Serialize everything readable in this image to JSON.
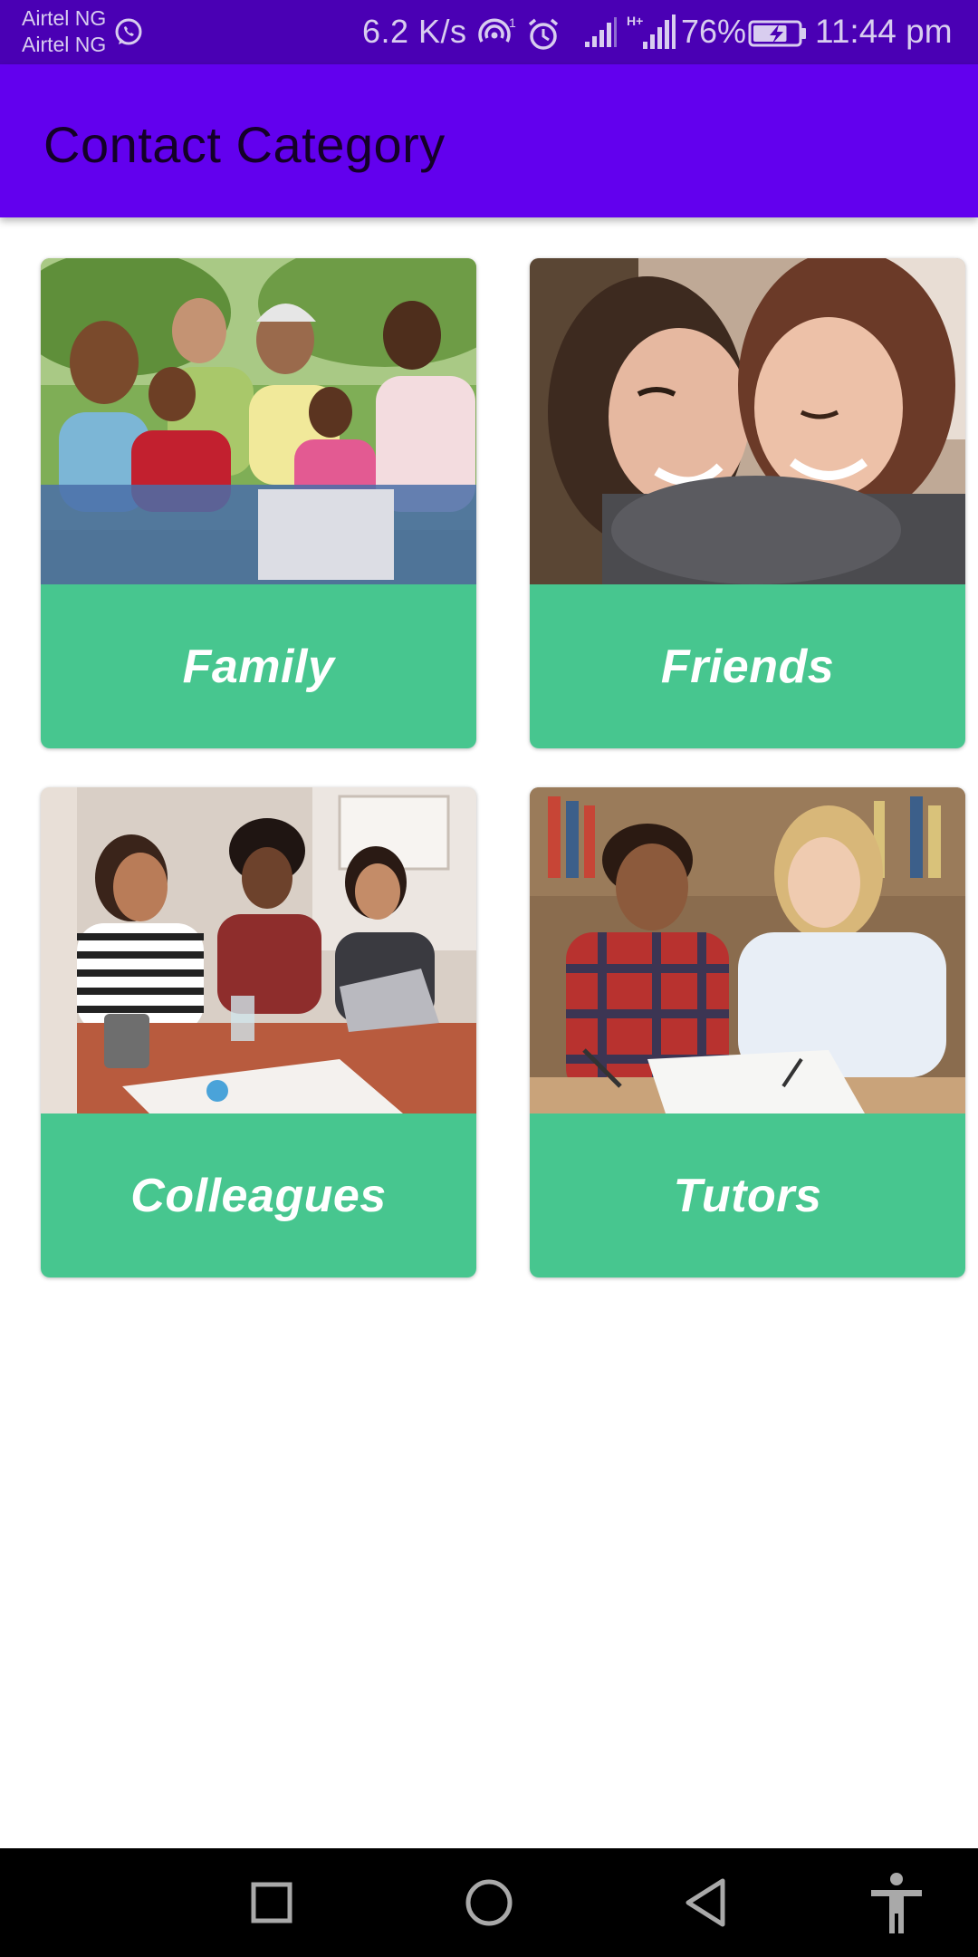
{
  "status_bar": {
    "carrier_1": "Airtel NG",
    "carrier_2": "Airtel NG",
    "net_speed": "6.2 K/s",
    "hotspot_count": "1",
    "battery_percent": "76%",
    "battery_level": 0.76,
    "time": "11:44 pm",
    "icons": [
      "whatsapp-icon",
      "hotspot-icon",
      "alarm-icon",
      "signal-icon",
      "signal-hplus-icon",
      "battery-charging-icon"
    ]
  },
  "app_bar": {
    "title": "Contact Category",
    "color": "#6200ee"
  },
  "categories": [
    {
      "label": "Family",
      "image": "family-photo"
    },
    {
      "label": "Friends",
      "image": "friends-photo"
    },
    {
      "label": "Colleagues",
      "image": "colleagues-photo"
    },
    {
      "label": "Tutors",
      "image": "tutors-photo"
    }
  ],
  "colors": {
    "status_bar": "#4a00b4",
    "card_label_bg": "#47c68f",
    "nav_bar": "#000000"
  },
  "nav_bar": {
    "icons": [
      "recents-square-icon",
      "home-circle-icon",
      "back-triangle-icon",
      "accessibility-icon"
    ]
  }
}
